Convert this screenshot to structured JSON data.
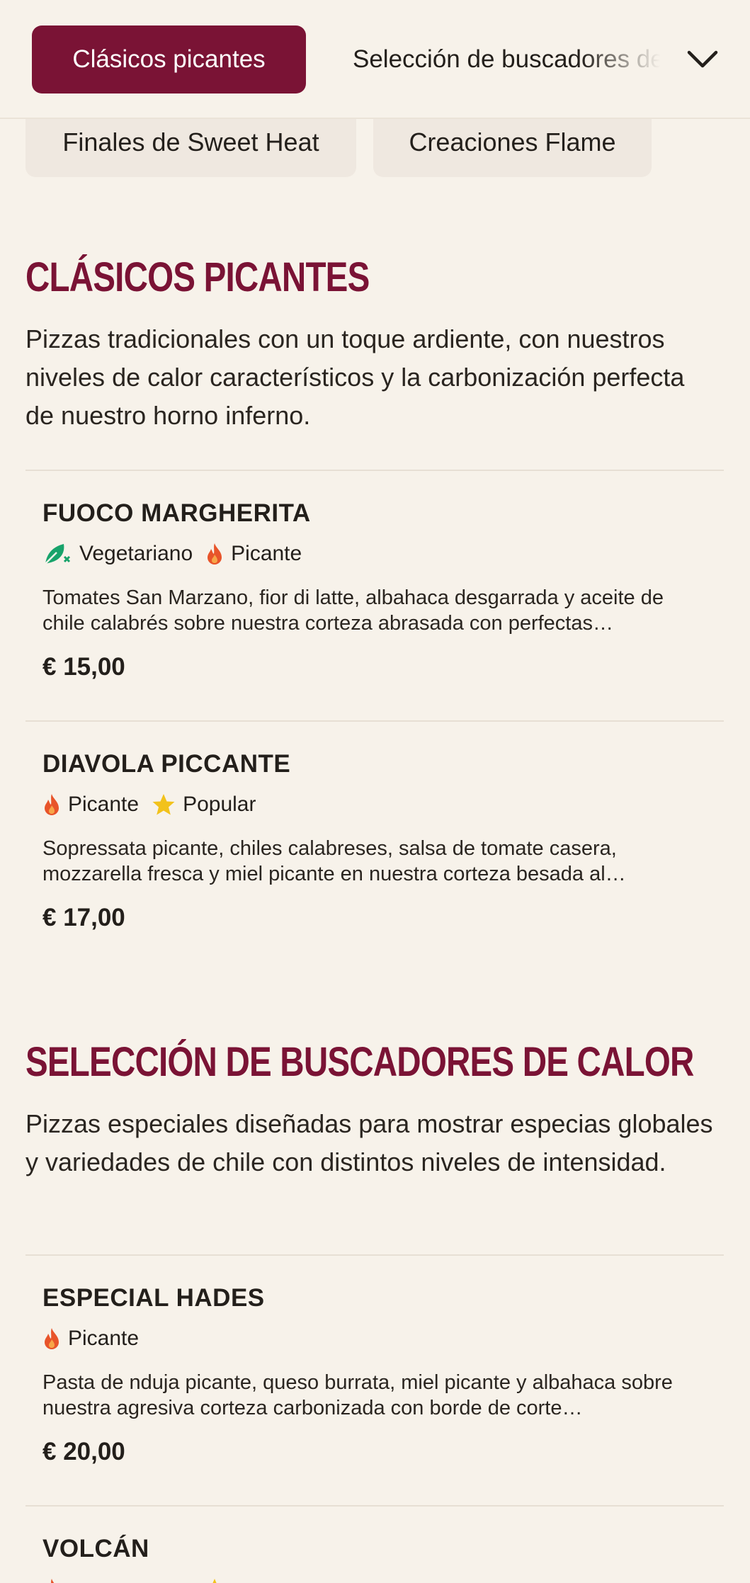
{
  "nav": {
    "active_tab": "Clásicos picantes",
    "next_tab": "Selección de buscadores de calor",
    "row2": [
      "Finales de Sweet Heat",
      "Creaciones Flame"
    ]
  },
  "sections": [
    {
      "title": "Clásicos picantes",
      "description": "Pizzas tradicionales con un toque ardiente, con nuestros niveles de calor característicos y la carbonización perfecta de nuestro horno inferno.",
      "items": [
        {
          "name": "FUOCO MARGHERITA",
          "tags": [
            {
              "label": "Vegetariano",
              "icon": "vegetarian-leaf-icon"
            },
            {
              "label": "Picante",
              "icon": "flame-icon"
            }
          ],
          "description": "Tomates San Marzano, fior di latte, albahaca desgarrada y aceite de chile calabrés sobre nuestra corteza abrasada con perfectas…",
          "price": "€ 15,00"
        },
        {
          "name": "DIAVOLA PICCANTE",
          "tags": [
            {
              "label": "Picante",
              "icon": "flame-icon"
            },
            {
              "label": "Popular",
              "icon": "star-icon"
            }
          ],
          "description": "Sopressata picante, chiles calabreses, salsa de tomate casera, mozzarella fresca y miel picante en nuestra corteza besada al…",
          "price": "€ 17,00"
        }
      ]
    },
    {
      "title": "Selección de buscadores de calor",
      "description": "Pizzas especiales diseñadas para mostrar especias globales y variedades de chile con distintos niveles de intensidad.",
      "items": [
        {
          "name": "ESPECIAL HADES",
          "tags": [
            {
              "label": "Picante",
              "icon": "flame-icon"
            }
          ],
          "description": "Pasta de nduja picante, queso burrata, miel picante y albahaca sobre nuestra agresiva corteza carbonizada con borde de corte…",
          "price": "€ 20,00"
        },
        {
          "name": "VOLCÁN",
          "tags": [],
          "description": "",
          "price": ""
        }
      ]
    }
  ],
  "colors": {
    "brand": "#7a1335",
    "background": "#f7f2ea",
    "flame": "#e8542a",
    "star": "#f2c21b",
    "vegetarian": "#18a36b"
  }
}
